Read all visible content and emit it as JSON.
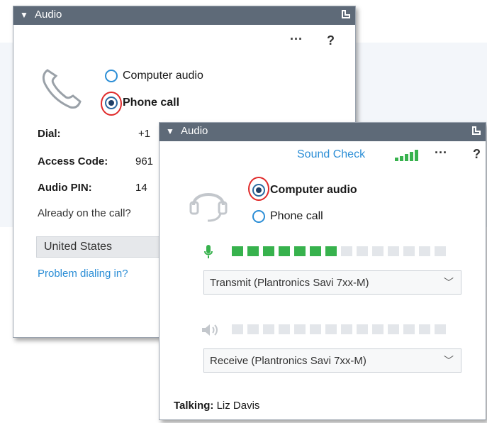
{
  "back_panel": {
    "title": "Audio",
    "more_icon": "···",
    "help_icon": "?",
    "options": [
      "Computer audio",
      "Phone call"
    ],
    "dial_label": "Dial:",
    "dial_value": "+1",
    "access_code_label": "Access Code:",
    "access_code_value": "961",
    "audio_pin_label": "Audio PIN:",
    "audio_pin_value": "14",
    "already_text": "Already on the call?",
    "country": "United States",
    "problem_link": "Problem dialing in?"
  },
  "front_panel": {
    "title": "Audio",
    "sound_check": "Sound Check",
    "more_icon": "···",
    "help_icon": "?",
    "options": [
      "Computer audio",
      "Phone call"
    ],
    "mic_level_segments_on": 7,
    "mic_level_segments_total": 14,
    "speaker_level_segments_on": 0,
    "transmit_device": "Transmit (Plantronics Savi 7xx-M)",
    "receive_device": "Receive (Plantronics Savi 7xx-M)",
    "talking_label": "Talking:",
    "talking_name": "Liz  Davis"
  },
  "colors": {
    "titlebar": "#5e6a78",
    "link": "#2c8ed6",
    "level_on": "#37b24d",
    "level_off": "#e3e6ea",
    "selection_ring": "#e02a2a"
  }
}
